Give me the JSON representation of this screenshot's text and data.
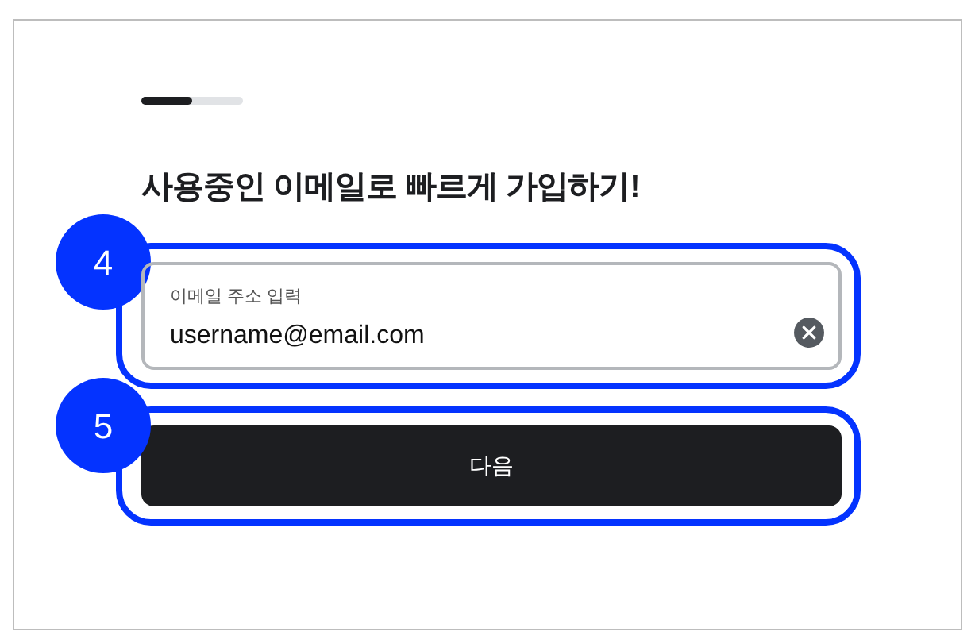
{
  "progress": {
    "level": 0.5
  },
  "title": "사용중인 이메일로 빠르게 가입하기!",
  "email_field": {
    "label": "이메일 주소 입력",
    "value": "username@email.com"
  },
  "next_button": {
    "label": "다음"
  },
  "annotations": [
    {
      "number": "4"
    },
    {
      "number": "5"
    }
  ]
}
